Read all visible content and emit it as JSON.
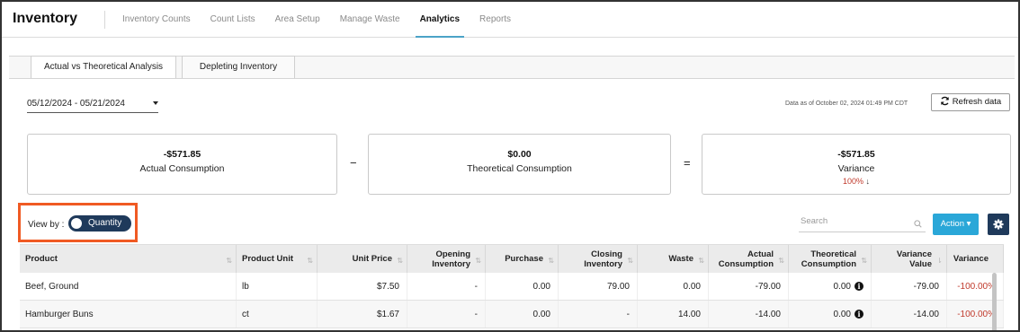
{
  "app": {
    "title": "Inventory"
  },
  "nav": [
    {
      "label": "Inventory Counts"
    },
    {
      "label": "Count Lists"
    },
    {
      "label": "Area Setup"
    },
    {
      "label": "Manage Waste"
    },
    {
      "label": "Analytics",
      "active": true
    },
    {
      "label": "Reports"
    }
  ],
  "tabs": [
    {
      "label": "Actual vs Theoretical Analysis",
      "active": true
    },
    {
      "label": "Depleting Inventory"
    }
  ],
  "filters": {
    "date_range": "05/12/2024 - 05/21/2024",
    "data_as_of": "Data as of October 02, 2024 01:49 PM CDT",
    "refresh_label": "Refresh data"
  },
  "summary": {
    "actual": {
      "amount": "-$571.85",
      "label": "Actual Consumption"
    },
    "minus": "−",
    "theoretical": {
      "amount": "$0.00",
      "label": "Theoretical Consumption"
    },
    "equals": "=",
    "variance": {
      "amount": "-$571.85",
      "label": "Variance",
      "percent": "100%",
      "arrow": "↓"
    }
  },
  "view_by": {
    "label": "View by :",
    "toggle_label": "Quantity"
  },
  "toolbar": {
    "search_placeholder": "Search",
    "action_label": "Action ▾"
  },
  "table": {
    "columns": [
      "Product",
      "Product Unit",
      "Unit Price",
      "Opening Inventory",
      "Purchase",
      "Closing Inventory",
      "Waste",
      "Actual Consumption",
      "Theoretical Consumption",
      "Variance Value",
      "Variance"
    ],
    "rows": [
      {
        "product": "Beef, Ground",
        "unit": "lb",
        "unit_price": "$7.50",
        "opening": "-",
        "purchase": "0.00",
        "closing": "79.00",
        "waste": "0.00",
        "actual": "-79.00",
        "theoretical": "0.00",
        "variance_value": "-79.00",
        "variance": "-100.00%"
      },
      {
        "product": "Hamburger Buns",
        "unit": "ct",
        "unit_price": "$1.67",
        "opening": "-",
        "purchase": "0.00",
        "closing": "-",
        "waste": "14.00",
        "actual": "-14.00",
        "theoretical": "0.00",
        "variance_value": "-14.00",
        "variance": "-100.00%"
      }
    ]
  },
  "colors": {
    "accent": "#2aa7d8",
    "navy": "#1f3a5b",
    "highlight": "#f05a23",
    "negative": "#c0392b"
  }
}
